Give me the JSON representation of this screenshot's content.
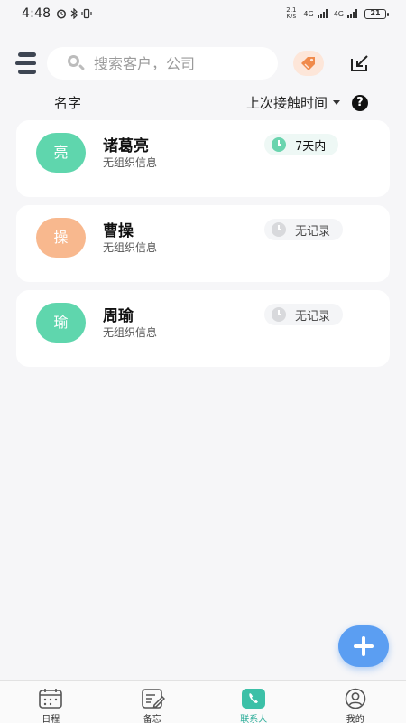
{
  "status_bar": {
    "time": "4:48",
    "net_speed_value": "2.1",
    "net_speed_unit": "K/s",
    "sig1_label": "4G",
    "sig2_label": "4G",
    "battery": "21"
  },
  "header": {
    "search_placeholder": "搜索客户，公司",
    "tag_button_icon": "tag-icon",
    "export_button_icon": "export-icon"
  },
  "sort_row": {
    "name_label": "名字",
    "sort_label": "上次接触时间",
    "help_label": "?"
  },
  "contacts": [
    {
      "avatar_text": "亮",
      "avatar_color": "#5fd6ad",
      "name": "诸葛亮",
      "org": "无组织信息",
      "last_contact": "7天内",
      "status": "active"
    },
    {
      "avatar_text": "操",
      "avatar_color": "#f8b88e",
      "name": "曹操",
      "org": "无组织信息",
      "last_contact": "无记录",
      "status": "none"
    },
    {
      "avatar_text": "瑜",
      "avatar_color": "#5fd6ad",
      "name": "周瑜",
      "org": "无组织信息",
      "last_contact": "无记录",
      "status": "none"
    }
  ],
  "fab": {
    "icon": "plus-icon"
  },
  "bottom_nav": [
    {
      "label": "日程",
      "icon": "calendar-icon",
      "active": false
    },
    {
      "label": "备忘",
      "icon": "memo-icon",
      "active": false
    },
    {
      "label": "联系人",
      "icon": "contacts-phone-icon",
      "active": true
    },
    {
      "label": "我的",
      "icon": "profile-icon",
      "active": false
    }
  ],
  "colors": {
    "accent": "#2fae9a",
    "fab": "#5b9ef2",
    "active_clock": "#6ad4ae",
    "tag_bg": "#fde6d9",
    "tag_fg": "#f08a4b"
  }
}
